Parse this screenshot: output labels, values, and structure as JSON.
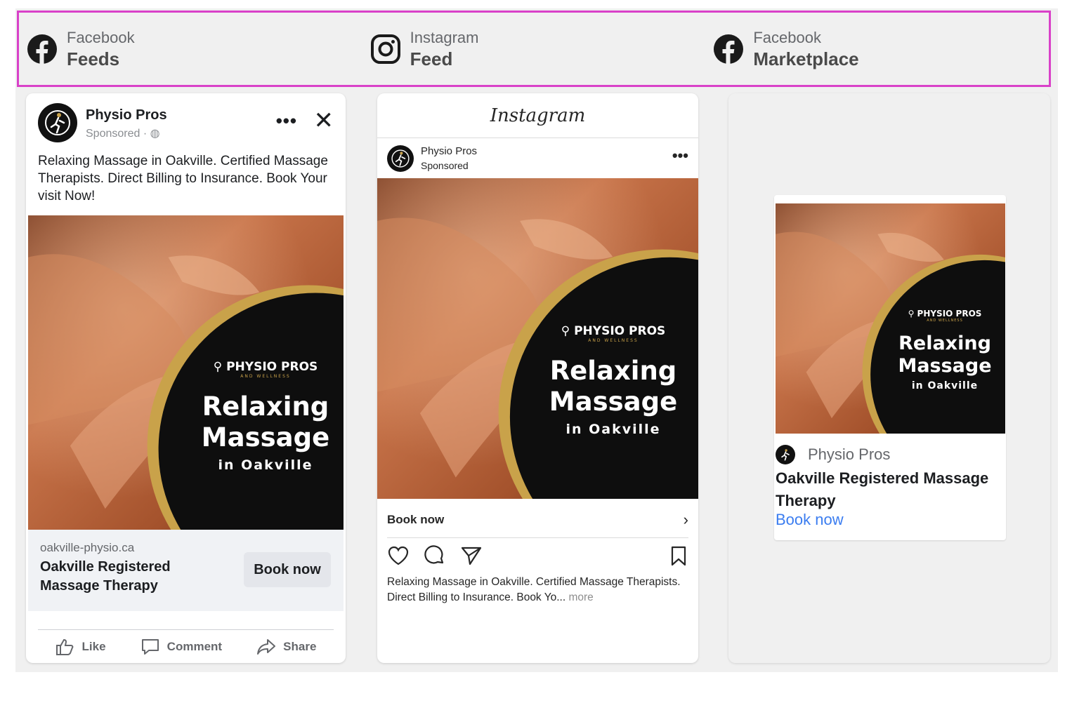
{
  "placements": [
    {
      "platform": "Facebook",
      "position": "Feeds",
      "icon": "facebook-icon"
    },
    {
      "platform": "Instagram",
      "position": "Feed",
      "icon": "instagram-icon"
    },
    {
      "platform": "Facebook",
      "position": "Marketplace",
      "icon": "facebook-icon"
    }
  ],
  "ad": {
    "page_name": "Physio Pros",
    "brand_text": "PHYSIO PROS",
    "brand_sub": "AND WELLNESS",
    "creative_line1": "Relaxing",
    "creative_line2": "Massage",
    "creative_line3": "in Oakville",
    "headline": "Oakville Registered Massage Therapy",
    "cta": "Book now"
  },
  "facebook_feed": {
    "sponsored": "Sponsored · ",
    "more": "•••",
    "close": "✕",
    "body": "Relaxing Massage in Oakville. Certified Massage Therapists. Direct Billing to Insurance. Book Your visit Now!",
    "domain": "oakville-physio.ca",
    "actions": {
      "like": "Like",
      "comment": "Comment",
      "share": "Share"
    }
  },
  "instagram_feed": {
    "logo": "Instagram",
    "sponsored": "Sponsored",
    "more": "•••",
    "chevron": "›",
    "caption": "Relaxing Massage in Oakville. Certified Massage Therapists. Direct Billing to Insurance. Book Yo...",
    "caption_more": "more"
  },
  "marketplace": {},
  "colors": {
    "placement_border": "#d941c9",
    "link_blue": "#3b7df0",
    "gold": "#c9a24a",
    "dark": "#0e0e0e",
    "skin": "#b8653a"
  }
}
